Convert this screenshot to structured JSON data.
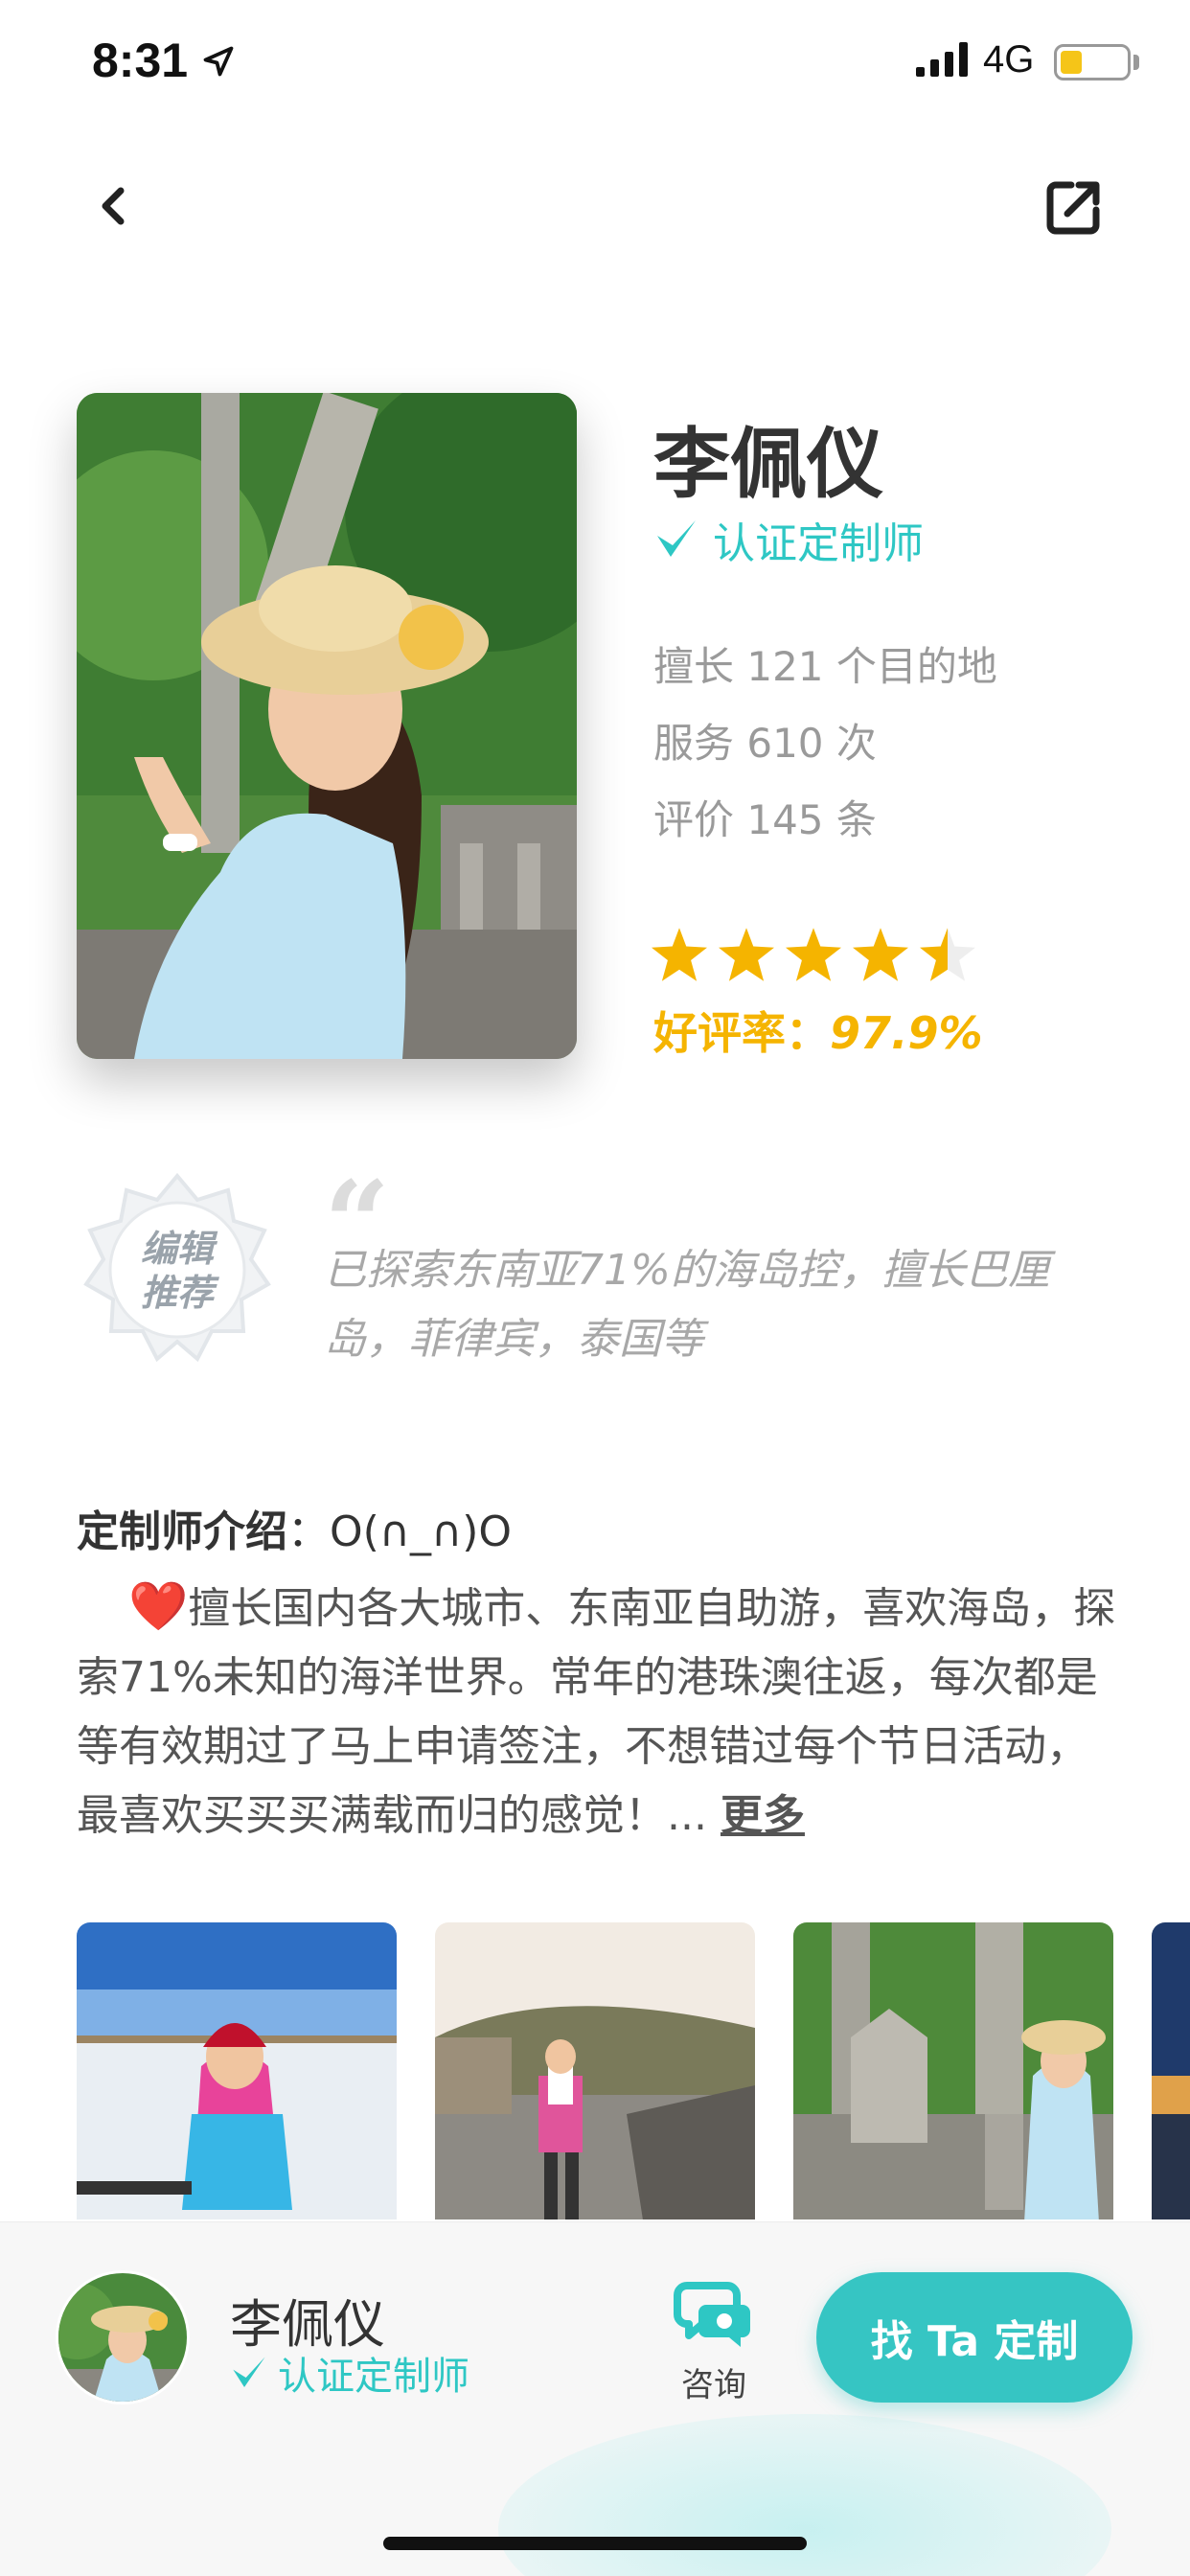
{
  "status_bar": {
    "time": "8:31",
    "network": "4G"
  },
  "profile": {
    "name": "李佩仪",
    "verified_label": "认证定制师",
    "stats": [
      "擅长 121 个目的地",
      "服务 610 次",
      "评价 145 条"
    ],
    "stars": 4.5,
    "rating_label": "好评率：",
    "rating_value": "97.9%"
  },
  "editor": {
    "badge_line1": "编辑",
    "badge_line2": "推荐",
    "quote": "已探索东南亚71%的海岛控，擅长巴厘岛，菲律宾，泰国等"
  },
  "intro": {
    "heading": "定制师介绍",
    "heading_suffix": "：O(∩_∩)O",
    "heart": "❤️",
    "text": "擅长国内各大城市、东南亚自助游，喜欢海岛，探索71%未知的海洋世界。常年的港珠澳往返，每次都是等有效期过了马上申请签注，不想错过每个节日活动，最喜欢买买买满载而归的感觉！...",
    "more": "更多"
  },
  "bottom_bar": {
    "name": "李佩仪",
    "verified_label": "认证定制师",
    "consult_label": "咨询",
    "cta_label": "找 Ta 定制"
  },
  "colors": {
    "accent": "#36c5c3",
    "star": "#f5b400"
  }
}
